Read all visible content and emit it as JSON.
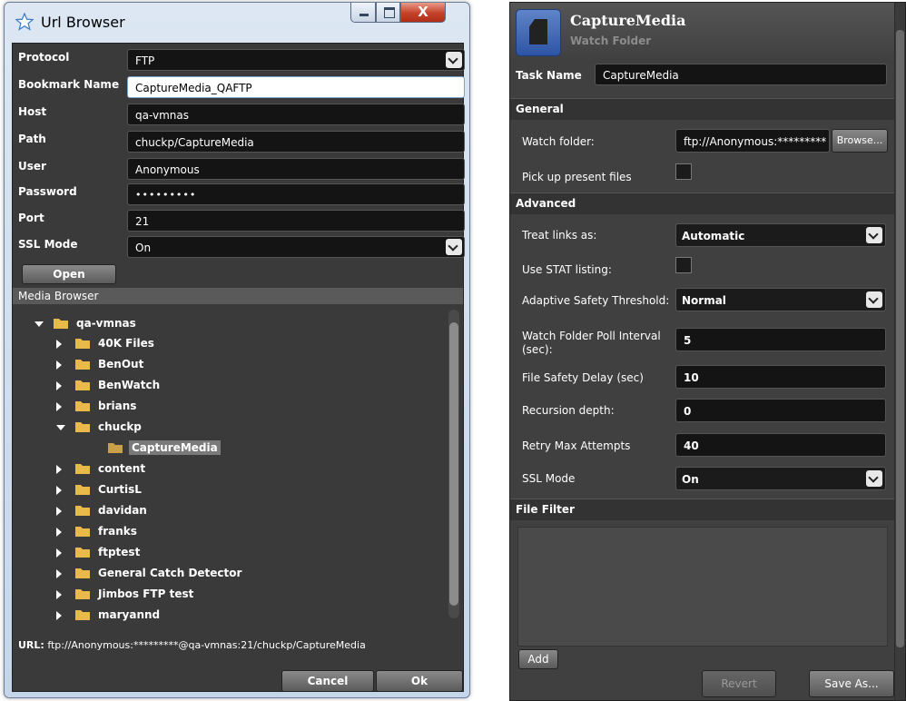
{
  "url_browser": {
    "title": "Url Browser",
    "close_glyph": "X",
    "fields": {
      "protocol": {
        "label": "Protocol",
        "value": "FTP"
      },
      "bookmark": {
        "label": "Bookmark Name",
        "value": "CaptureMedia_QAFTP"
      },
      "host": {
        "label": "Host",
        "value": "qa-vmnas"
      },
      "path": {
        "label": "Path",
        "value": "chuckp/CaptureMedia"
      },
      "user": {
        "label": "User",
        "value": "Anonymous"
      },
      "password": {
        "label": "Password",
        "value": "•••••••••"
      },
      "port": {
        "label": "Port",
        "value": "21"
      },
      "ssl": {
        "label": "SSL Mode",
        "value": "On"
      }
    },
    "open_label": "Open",
    "media_browser_label": "Media Browser",
    "tree": [
      {
        "label": "qa-vmnas",
        "expanded": true
      },
      {
        "label": "40K Files"
      },
      {
        "label": "BenOut"
      },
      {
        "label": "BenWatch"
      },
      {
        "label": "brians"
      },
      {
        "label": "chuckp",
        "expanded": true
      },
      {
        "label": "CaptureMedia",
        "selected": true
      },
      {
        "label": "content"
      },
      {
        "label": "CurtisL"
      },
      {
        "label": "davidan"
      },
      {
        "label": "franks"
      },
      {
        "label": "ftptest"
      },
      {
        "label": "General Catch Detector"
      },
      {
        "label": "Jimbos FTP test"
      },
      {
        "label": "maryannd"
      }
    ],
    "url_label": "URL:",
    "url_value": "ftp://Anonymous:*********@qa-vmnas:21/chuckp/CaptureMedia",
    "cancel_label": "Cancel",
    "ok_label": "Ok"
  },
  "task": {
    "name": "CaptureMedia",
    "subtitle": "Watch Folder",
    "task_name_label": "Task Name",
    "task_name_value": "CaptureMedia",
    "general_label": "General",
    "watch_folder_label": "Watch folder:",
    "watch_folder_value": "ftp://Anonymous:*********",
    "browse_label": "Browse...",
    "pickup_label": "Pick up present files",
    "advanced_label": "Advanced",
    "treat_links_label": "Treat links as:",
    "treat_links_value": "Automatic",
    "stat_label": "Use STAT listing:",
    "adaptive_label": "Adaptive Safety Threshold:",
    "adaptive_value": "Normal",
    "poll_label": "Watch Folder Poll Interval (sec):",
    "poll_value": "5",
    "safety_delay_label": "File Safety Delay (sec)",
    "safety_delay_value": "10",
    "recursion_label": "Recursion depth:",
    "recursion_value": "0",
    "retry_label": "Retry Max Attempts",
    "retry_value": "40",
    "ssl_label": "SSL Mode",
    "ssl_value": "On",
    "file_filter_label": "File Filter",
    "add_label": "Add",
    "revert_label": "Revert",
    "saveas_label": "Save As..."
  },
  "colors": {
    "panel": "#404040",
    "field": "#141414",
    "folder": "#e9b949",
    "folder_selected": "#c9a04a"
  }
}
